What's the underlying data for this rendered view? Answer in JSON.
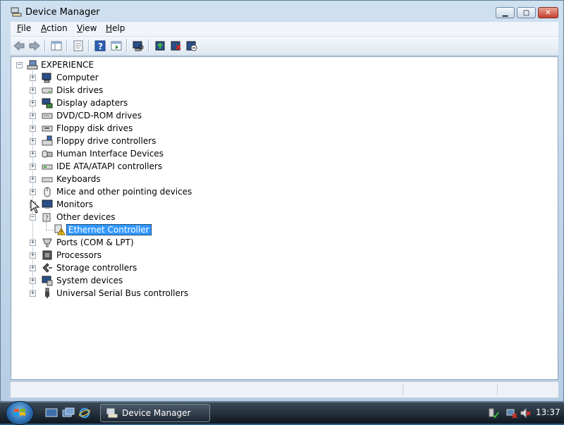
{
  "window": {
    "title": "Device Manager",
    "caption_min": "▁",
    "caption_max": "▢",
    "caption_close": "✕"
  },
  "menu": {
    "file": "F",
    "file_rest": "ile",
    "action": "A",
    "action_rest": "ction",
    "view": "V",
    "view_rest": "iew",
    "help": "H",
    "help_rest": "elp"
  },
  "toolbar": {
    "buttons": [
      "back-icon",
      "forward-icon",
      "console-tree-icon",
      "properties-icon",
      "help-icon",
      "action-pane-icon",
      "scan-hardware-icon",
      "update-driver-icon",
      "uninstall-icon",
      "disable-icon"
    ]
  },
  "tree": {
    "root": "EXPERIENCE",
    "items": [
      {
        "label": "Computer",
        "icon": "computer-icon"
      },
      {
        "label": "Disk drives",
        "icon": "disk-drive-icon"
      },
      {
        "label": "Display adapters",
        "icon": "display-adapter-icon"
      },
      {
        "label": "DVD/CD-ROM drives",
        "icon": "dvd-drive-icon"
      },
      {
        "label": "Floppy disk drives",
        "icon": "floppy-drive-icon"
      },
      {
        "label": "Floppy drive controllers",
        "icon": "floppy-controller-icon"
      },
      {
        "label": "Human Interface Devices",
        "icon": "hid-icon"
      },
      {
        "label": "IDE ATA/ATAPI controllers",
        "icon": "ide-controller-icon"
      },
      {
        "label": "Keyboards",
        "icon": "keyboard-icon"
      },
      {
        "label": "Mice and other pointing devices",
        "icon": "mouse-icon"
      },
      {
        "label": "Monitors",
        "icon": "monitor-icon"
      },
      {
        "label": "Other devices",
        "icon": "other-devices-icon"
      },
      {
        "label": "Ethernet Controller",
        "icon": "warning-device-icon"
      },
      {
        "label": "Ports (COM & LPT)",
        "icon": "port-icon"
      },
      {
        "label": "Processors",
        "icon": "processor-icon"
      },
      {
        "label": "Storage controllers",
        "icon": "storage-controller-icon"
      },
      {
        "label": "System devices",
        "icon": "system-device-icon"
      },
      {
        "label": "Universal Serial Bus controllers",
        "icon": "usb-icon"
      }
    ]
  },
  "taskbar": {
    "task_label": "Device Manager",
    "clock": "13:37"
  }
}
